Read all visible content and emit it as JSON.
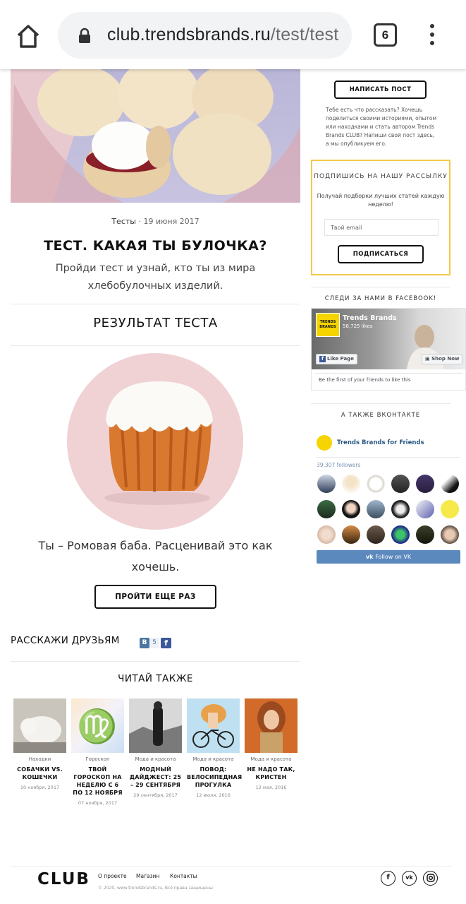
{
  "browser": {
    "url_domain": "club.trendsbrands.ru",
    "url_path": "/test/test",
    "tab_count": "6"
  },
  "article": {
    "category": "Тесты",
    "separator": "·",
    "date": "19 июня 2017",
    "title": "ТЕСТ. КАКАЯ ТЫ БУЛОЧКА?",
    "lead": "Пройди тест и узнай, кто ты из мира хлебобулочных изделий.",
    "result_heading": "РЕЗУЛЬТАТ ТЕСТА",
    "result_text": "Ты – Ромовая баба. Расценивай это как хочешь.",
    "retry_label": "ПРОЙТИ ЕЩЕ РАЗ"
  },
  "share": {
    "label": "РАССКАЖИ ДРУЗЬЯМ",
    "vk_label": "В",
    "vk_count": "5",
    "fb_label": "f"
  },
  "read_also": {
    "heading": "ЧИТАЙ ТАКЖЕ",
    "cards": [
      {
        "category": "Находки",
        "title": "СОБАЧКИ VS. КОШЕЧКИ",
        "date": "10 ноября, 2017"
      },
      {
        "category": "Гороскоп",
        "title": "ТВОЙ ГОРОСКОП НА НЕДЕЛЮ С 6 ПО 12 НОЯБРЯ",
        "date": "07 ноября, 2017"
      },
      {
        "category": "Мода и красота",
        "title": "МОДНЫЙ ДАЙДЖЕСТ: 25 – 29 СЕНТЯБРЯ",
        "date": "29 сентября, 2017"
      },
      {
        "category": "Мода и красота",
        "title": "ПОВОД: ВЕЛОСИПЕДНАЯ ПРОГУЛКА",
        "date": "12 июля, 2016"
      },
      {
        "category": "Мода и красота",
        "title": "НЕ НАДО ТАК, КРИСТЕН",
        "date": "12 мая, 2016"
      }
    ]
  },
  "sidebar": {
    "write_post_label": "НАПИСАТЬ ПОСТ",
    "write_post_text": "Тебе есть что рассказать? Хочешь поделиться своими историями, опытом или находками и стать автором Trends Brands CLUB? Напиши свой пост здесь, а мы опубликуем его.",
    "subscribe_title": "ПОДПИШИСЬ НА НАШУ РАССЫЛКУ",
    "subscribe_desc": "Получай подборки лучших статей каждую неделю!",
    "email_placeholder": "Твой email",
    "subscribe_button": "ПОДПИСАТЬСЯ",
    "facebook_heading": "СЛЕДИ ЗА НАМИ В FACEBOOK!",
    "fb_page_name": "Trends Brands",
    "fb_likes": "58,725 likes",
    "fb_logo_text": "TRENDS BRANDS",
    "fb_like_page": "Like Page",
    "fb_shop_now": "Shop Now",
    "fb_first_friends": "Be the first of your friends to like this",
    "vk_heading": "А ТАКЖЕ ВКОНТАКТЕ",
    "vk_group_name": "Trends Brands for Friends",
    "vk_followers": "39,307 followers",
    "vk_follow_button": "Follow on VK"
  },
  "footer": {
    "logo": "CLUB",
    "links": [
      "О проекте",
      "Магазин",
      "Контакты"
    ],
    "copyright": "© 2020, www.trendsbrands.ru, Все права защищены"
  },
  "colors": {
    "accent_yellow": "#f2c94c",
    "vk_blue": "#5b88bd",
    "fb_blue": "#3b5998",
    "result_circle": "#f0d2d4"
  }
}
